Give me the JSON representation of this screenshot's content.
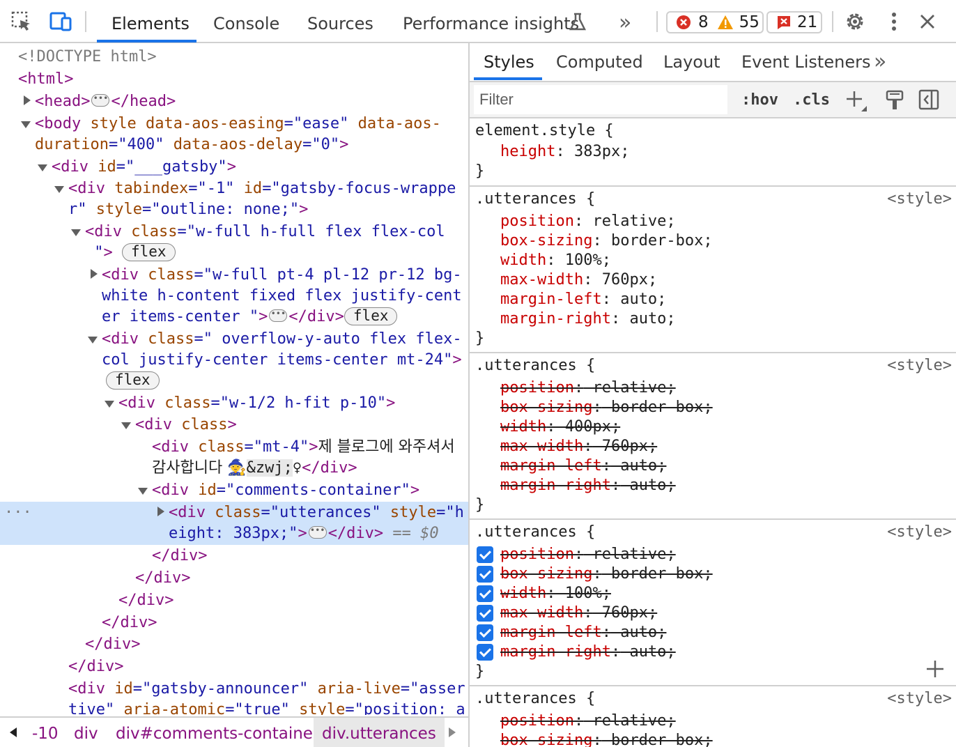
{
  "toolbar": {
    "tabs": [
      "Elements",
      "Console",
      "Sources",
      "Performance insights"
    ],
    "more": "»",
    "errors": "8",
    "warnings": "55",
    "issues": "21"
  },
  "dom": {
    "doctype": "<!DOCTYPE html>",
    "html": "<html>",
    "head_open": "<head>",
    "head_close": "</head>",
    "body_open": "<body ",
    "body_a1": "style ",
    "body_a2": "data-aos-easing",
    "body_v2": "=\"ease\" ",
    "body_a3": "data-aos-",
    "body_a3b": "duration",
    "body_v3": "=\"400\" ",
    "body_a4": "data-aos-delay",
    "body_v4": "=\"0\"",
    "body_end": ">",
    "l4_tag": "<div ",
    "l4_an": "id",
    "l4_av": "=\"___gatsby\"",
    "l4_end": ">",
    "l5_tag": "<div ",
    "l5_an1": "tabindex",
    "l5_av1": "=\"-1\" ",
    "l5_an2": "id",
    "l5_av2": "=\"gatsby-focus-wrappe",
    "l5b_av": "r\" ",
    "l5b_an": "style",
    "l5b_av2": "=\"outline: none;\"",
    "l5b_end": ">",
    "l6_tag": "<div ",
    "l6_an": "class",
    "l6_av": "=\"w-full h-full flex flex-col",
    "l6b_av": " \"",
    "l6b_end": ">",
    "flex_badge": "flex",
    "l7_tag": "<div ",
    "l7_an": "class",
    "l7_av": "=\"w-full pt-4 pl-12 pr-12 bg-",
    "l7b_av": "white h-content fixed flex justify-cent",
    "l7c_av": "er items-center \"",
    "l7c_end": ">",
    "l7c_close": "</div>",
    "l8_tag": "<div ",
    "l8_an": "class",
    "l8_av": "=\" overflow-y-auto flex flex-",
    "l8b_av": "col justify-center items-center mt-24\"",
    "l8b_end": ">",
    "l9_tag": "<div ",
    "l9_an": "class",
    "l9_av": "=\"w-1/2 h-fit p-10\"",
    "l9_end": ">",
    "l10_tag": "<div ",
    "l10_an": "class",
    "l10_end": ">",
    "l11_tag": "<div ",
    "l11_an": "class",
    "l11_av": "=\"mt-4\"",
    "l11_end": ">",
    "l11_text": "제 블로그에 와주셔서",
    "l11b_text": "감사합니다 ",
    "l11b_emoji": "🧙",
    "l11b_ent": "&zwj;",
    "l11b_text2": "♀",
    "l11b_close": "</div>",
    "l12_tag": "<div ",
    "l12_an": "id",
    "l12_av": "=\"comments-container\"",
    "l12_end": ">",
    "sel_tag": "<div ",
    "sel_an1": "class",
    "sel_av1": "=\"utterances\" ",
    "sel_an2": "style",
    "sel_av2": "=\"h",
    "selb_av": "eight: 383px;\"",
    "selb_end": ">",
    "selb_close": "</div>",
    "selb_eq": " == ",
    "selb_dollar": "$0",
    "sel_dots": "···",
    "close_div": "</div>",
    "last_tag": "<div ",
    "last_an1": "id",
    "last_av1": "=\"gatsby-announcer\" ",
    "last_an2": "aria-live",
    "last_av2": "=\"asser",
    "lastb_av": "tive\" ",
    "lastb_an": "aria-atomic",
    "lastb_av2": "=\"true\" ",
    "lastb_an2": "style",
    "lastb_av3": "=\"position: a"
  },
  "breadcrumbs": [
    "-10",
    "div",
    "div#comments-container",
    "div.utterances"
  ],
  "styles_panel": {
    "tabs": [
      "Styles",
      "Computed",
      "Layout",
      "Event Listeners"
    ],
    "more": "»",
    "filter_placeholder": "Filter",
    "hov": ":hov",
    "cls": ".cls",
    "element_style_selector": "element.style {",
    "element_style_prop": "height",
    "element_style_val": " 383px;",
    "colon": ":",
    "close_brace": "}",
    "rule_selector": ".utterances {",
    "source": "<style>",
    "rule1": [
      {
        "p": "position",
        "v": " relative;"
      },
      {
        "p": "box-sizing",
        "v": " border-box;"
      },
      {
        "p": "width",
        "v": " 100%;"
      },
      {
        "p": "max-width",
        "v": " 760px;"
      },
      {
        "p": "margin-left",
        "v": " auto;"
      },
      {
        "p": "margin-right",
        "v": " auto;"
      }
    ],
    "rule2": [
      {
        "p": "position",
        "v": " relative;"
      },
      {
        "p": "box-sizing",
        "v": " border-box;"
      },
      {
        "p": "width",
        "v": " 400px;"
      },
      {
        "p": "max-width",
        "v": " 760px;"
      },
      {
        "p": "margin-left",
        "v": " auto;"
      },
      {
        "p": "margin-right",
        "v": " auto;"
      }
    ],
    "rule3": [
      {
        "p": "position",
        "v": " relative;"
      },
      {
        "p": "box-sizing",
        "v": " border-box;"
      },
      {
        "p": "width",
        "v": " 100%;"
      },
      {
        "p": "max-width",
        "v": " 760px;"
      },
      {
        "p": "margin-left",
        "v": " auto;"
      },
      {
        "p": "margin-right",
        "v": " auto;"
      }
    ],
    "rule4": [
      {
        "p": "position",
        "v": " relative;"
      },
      {
        "p": "box-sizing",
        "v": " border-box;"
      }
    ]
  },
  "colors": {
    "accent": "#1a73e8",
    "selected_row": "#cfe3fb",
    "tag": "#881280",
    "attr_name": "#994500",
    "attr_value": "#1a1aa6",
    "css_prop": "#c80000"
  }
}
